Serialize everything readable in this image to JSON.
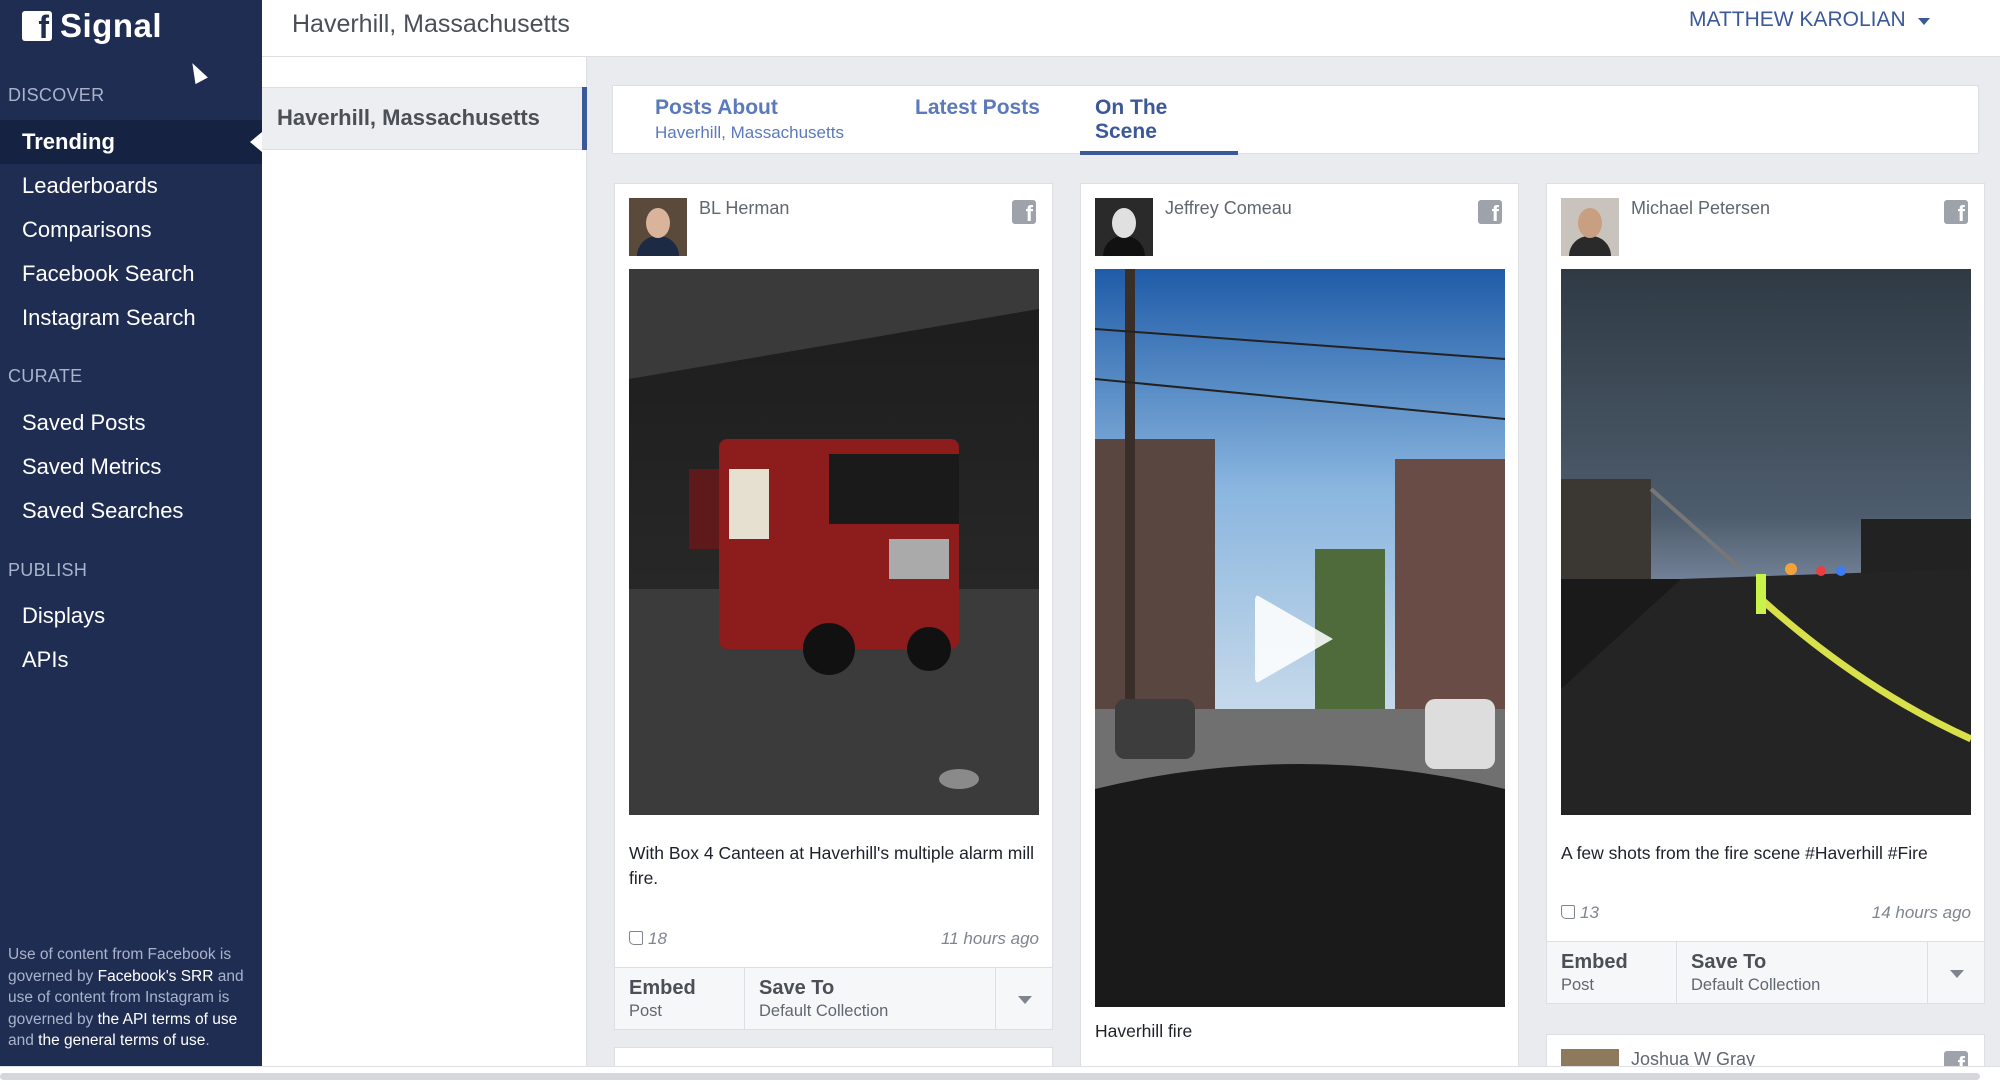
{
  "app": {
    "name": "Signal",
    "logo_letter": "f"
  },
  "sidebar": {
    "sections": [
      {
        "heading": "DISCOVER",
        "items": [
          {
            "label": "Trending",
            "active": true
          },
          {
            "label": "Leaderboards"
          },
          {
            "label": "Comparisons"
          },
          {
            "label": "Facebook Search"
          },
          {
            "label": "Instagram Search"
          }
        ]
      },
      {
        "heading": "CURATE",
        "items": [
          {
            "label": "Saved Posts"
          },
          {
            "label": "Saved Metrics"
          },
          {
            "label": "Saved Searches"
          }
        ]
      },
      {
        "heading": "PUBLISH",
        "items": [
          {
            "label": "Displays"
          },
          {
            "label": "APIs"
          }
        ]
      }
    ],
    "footer": {
      "t1": "Use of content from Facebook is governed by ",
      "link1": "Facebook's SRR",
      "t2": " and use of content from Instagram is governed by ",
      "link2": "the API terms of use",
      "t3": " and ",
      "link3": "the general terms of use",
      "t4": "."
    }
  },
  "header": {
    "title": "Haverhill, Massachusetts",
    "user": "MATTHEW KAROLIAN"
  },
  "locations": {
    "selected": "Haverhill, Massachusetts"
  },
  "tabs": [
    {
      "label": "Posts About",
      "sub": "Haverhill, Massachusetts"
    },
    {
      "label": "Latest Posts",
      "sub": ""
    },
    {
      "label": "On The Scene",
      "sub": "",
      "active": true
    }
  ],
  "posts": [
    {
      "author": "BL Herman",
      "network_icon": "facebook-icon",
      "media": "photo",
      "text": "With Box 4 Canteen at Haverhill's multiple alarm mill fire.",
      "likes": "18",
      "time": "11 hours ago",
      "embed_label": "Embed",
      "embed_sub": "Post",
      "save_label": "Save To",
      "save_sub": "Default Collection"
    },
    {
      "author": "Jeffrey Comeau",
      "network_icon": "facebook-icon",
      "media": "video",
      "text": "Haverhill fire"
    },
    {
      "author": "Michael Petersen",
      "network_icon": "facebook-icon",
      "media": "photo",
      "text": "A few shots from the fire scene #Haverhill #Fire",
      "likes": "13",
      "time": "14 hours ago",
      "embed_label": "Embed",
      "embed_sub": "Post",
      "save_label": "Save To",
      "save_sub": "Default Collection"
    },
    {
      "author": "Joshua W Gray",
      "network_icon": "facebook-icon"
    }
  ]
}
